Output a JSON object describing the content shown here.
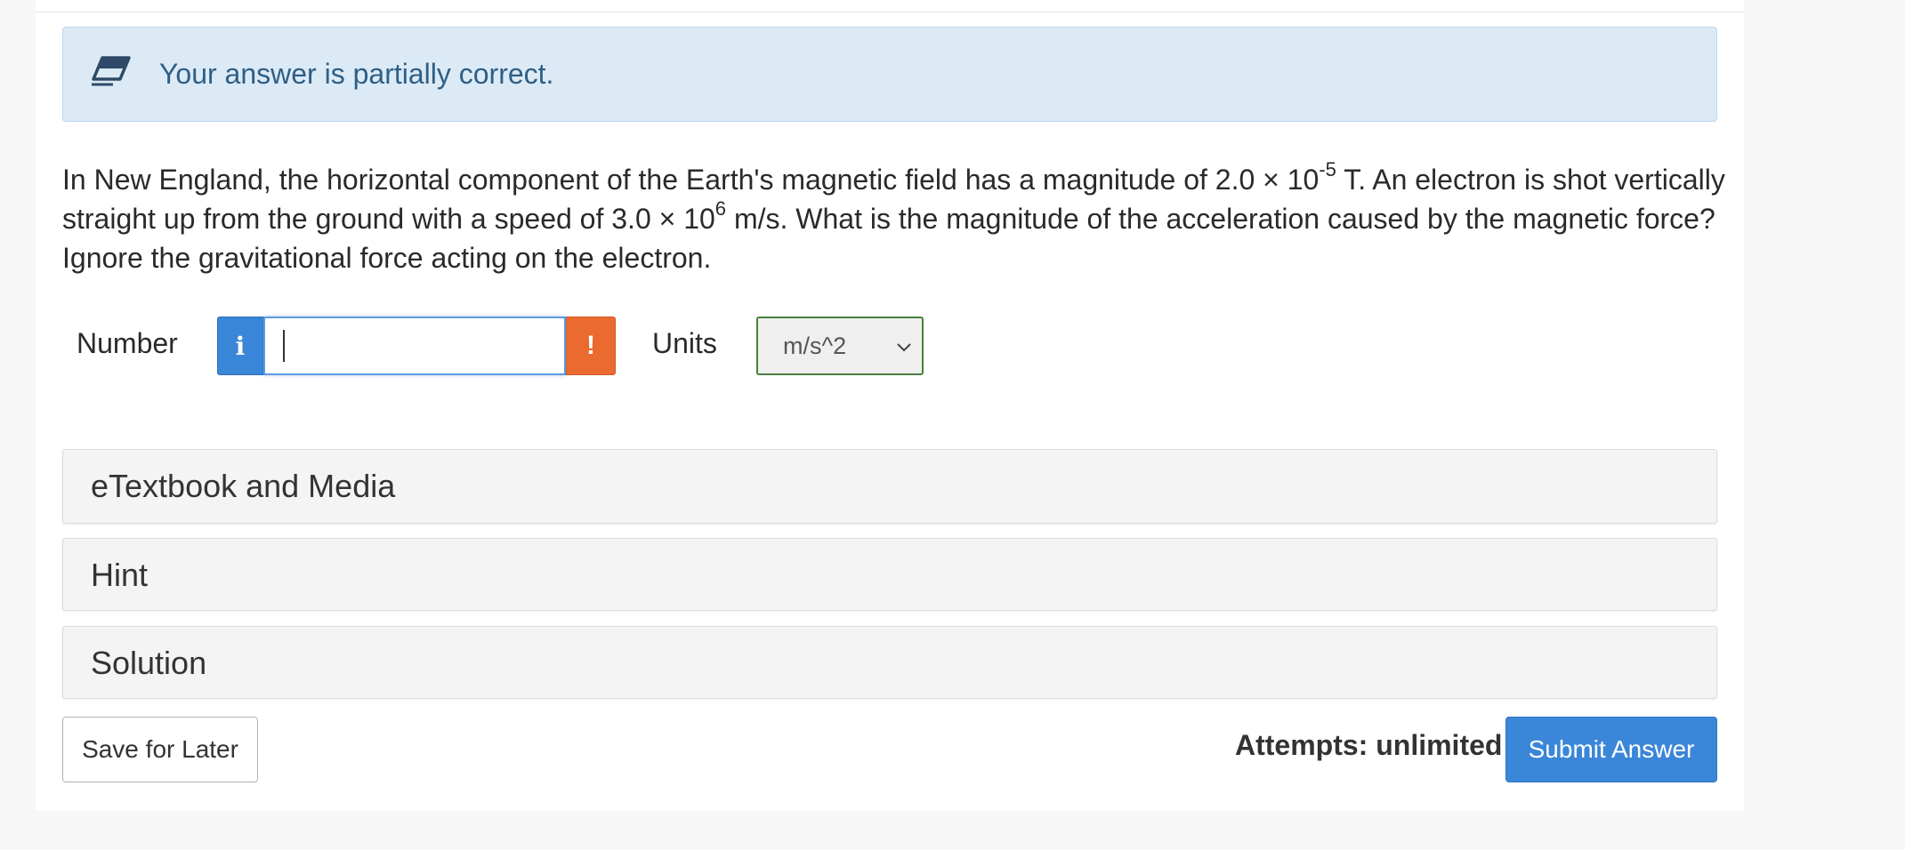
{
  "alert": {
    "icon": "eraser-icon",
    "message": "Your answer is partially correct."
  },
  "question": {
    "part1": "In New England, the horizontal component of the Earth's magnetic field has a magnitude of 2.0 × 10",
    "sup1": "-5",
    "part2": " T. An electron is shot vertically straight up from the ground with a speed of 3.0 × 10",
    "sup2": "6",
    "part3": " m/s. What is the magnitude of the acceleration caused by the magnetic force? Ignore the gravitational force acting on the electron."
  },
  "answer": {
    "number_label": "Number",
    "info_icon_text": "i",
    "number_value": "",
    "warning_icon_text": "!",
    "units_label": "Units",
    "units_selected": "m/s^2"
  },
  "accordions": {
    "etextbook": "eTextbook and Media",
    "hint": "Hint",
    "solution": "Solution"
  },
  "footer": {
    "save_label": "Save for Later",
    "attempts": "Attempts: unlimited",
    "submit_label": "Submit Answer"
  },
  "colors": {
    "alert_bg": "#dceaf6",
    "alert_text": "#2e5f86",
    "info_blue": "#3a86d8",
    "warning_orange": "#ea6a2f",
    "units_border": "#4a7f3c"
  }
}
